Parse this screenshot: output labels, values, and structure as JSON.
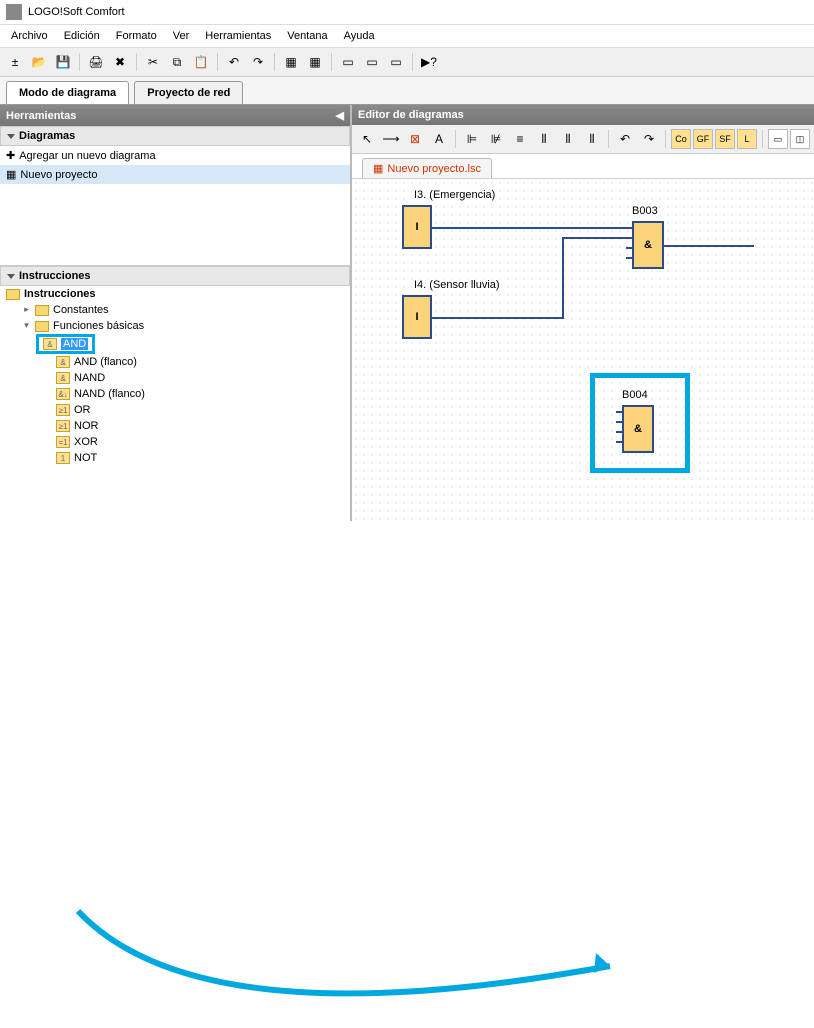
{
  "app": {
    "title": "LOGO!Soft Comfort"
  },
  "menu": {
    "archivo": "Archivo",
    "edicion": "Edición",
    "formato": "Formato",
    "ver": "Ver",
    "herramientas": "Herramientas",
    "ventana": "Ventana",
    "ayuda": "Ayuda"
  },
  "tabs": {
    "diagram_mode": "Modo de diagrama",
    "network_project": "Proyecto de red"
  },
  "left": {
    "tools_header": "Herramientas",
    "diagrams_header": "Diagramas",
    "add_new": "Agregar un nuevo diagrama",
    "new_project": "Nuevo proyecto",
    "instructions_header": "Instrucciones",
    "tree": {
      "root": "Instrucciones",
      "constantes": "Constantes",
      "funciones_basicas": "Funciones básicas",
      "items": {
        "and": "AND",
        "and_flanco": "AND (flanco)",
        "nand": "NAND",
        "nand_flanco": "NAND (flanco)",
        "or": "OR",
        "nor": "NOR",
        "xor": "XOR",
        "not": "NOT"
      }
    }
  },
  "editor": {
    "header": "Editor de diagramas",
    "tab_label": "Nuevo proyecto.lsc",
    "blocks": {
      "i3": {
        "label": "I3. (Emergencia)",
        "symbol": "I"
      },
      "i4": {
        "label": "I4. (Sensor lluvia)",
        "symbol": "I"
      },
      "b003": {
        "label": "B003",
        "symbol": "&"
      },
      "b004": {
        "label": "B004",
        "symbol": "&"
      }
    },
    "toolbtns": {
      "co": "Co",
      "gf": "GF",
      "sf": "SF",
      "l": "L"
    }
  }
}
